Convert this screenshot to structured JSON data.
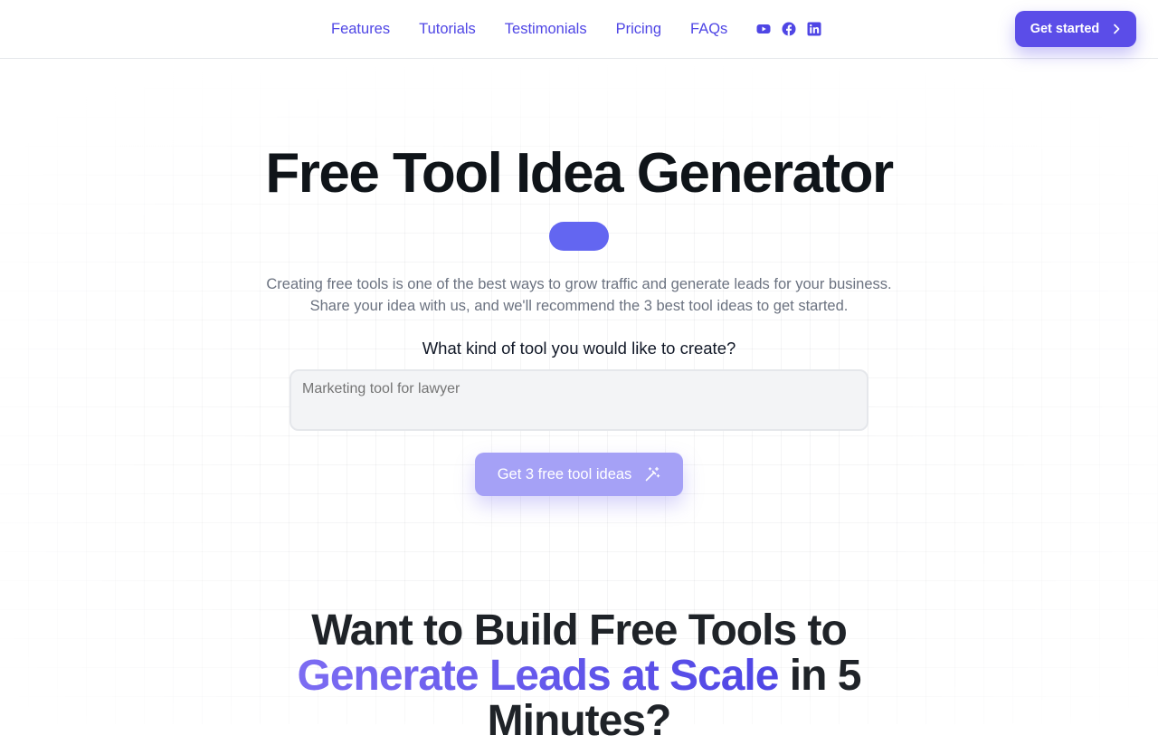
{
  "nav": {
    "links": [
      "Features",
      "Tutorials",
      "Testimonials",
      "Pricing",
      "FAQs"
    ],
    "social_icons": [
      "youtube-icon",
      "facebook-icon",
      "linkedin-icon"
    ],
    "cta_label": "Get started"
  },
  "hero": {
    "title": "Free Tool Idea Generator",
    "description_line1": "Creating free tools is one of the best ways to grow traffic and generate leads for your business.",
    "description_line2": "Share your idea with us, and we'll recommend the 3 best tool ideas to get started.",
    "prompt_label": "What kind of tool you would like to create?",
    "input_placeholder": "Marketing tool for lawyer",
    "input_value": "",
    "submit_label": "Get 3 free tool ideas"
  },
  "section2": {
    "headline_part1": "Want to Build Free Tools to",
    "headline_highlight": "Generate Leads at Scale",
    "headline_part2": "in 5",
    "headline_part3": "Minutes?"
  },
  "colors": {
    "accent": "#4f46e5",
    "cta_background": "#5b4de8",
    "pill": "#6366f1",
    "submit_disabled": "#a5a1f6"
  }
}
